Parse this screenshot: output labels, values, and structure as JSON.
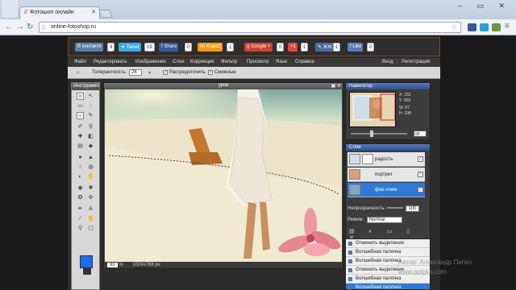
{
  "browser": {
    "tab_title": "Фотошоп онлайн",
    "url": "online-fotoshop.ru",
    "win_controls": "– ▭ ✕"
  },
  "social": [
    {
      "label": "контакте",
      "count": "4",
      "color": "#5b7fa6"
    },
    {
      "label": "Tweet",
      "count": "19",
      "color": "#3ea9e0"
    },
    {
      "label": "Share",
      "count": "0",
      "color": "#3b5998"
    },
    {
      "label": "Класс!",
      "count": "1",
      "color": "#f39a1e"
    },
    {
      "label": "Google +",
      "count": "0",
      "color": "#c9432f"
    },
    {
      "label": "+1",
      "count": "1",
      "color": "#d94c3d"
    },
    {
      "label": "ЖЖ",
      "count": "1",
      "color": "#4a6a9e"
    },
    {
      "label": "Like",
      "count": "0",
      "color": "#5a7ab8"
    }
  ],
  "menu": [
    "Файл",
    "Редактировать",
    "Изображение",
    "Слои",
    "Коррекция",
    "Фильтр",
    "Просмотр",
    "Язык",
    "Справка"
  ],
  "auth": {
    "login": "Вход",
    "register": "Регистрация"
  },
  "options": {
    "tolerance_label": "Толерантность:",
    "tolerance_value": "26",
    "smooth_label": "Рассредоточить",
    "contiguous_label": "Смежные"
  },
  "tools_title": "Инструменты",
  "canvas": {
    "title": "урок",
    "zoom": "90",
    "size": "1024x768 px"
  },
  "navigator": {
    "title": "Навигатор",
    "x_label": "X:",
    "x": "152",
    "y_label": "Y:",
    "y": "903",
    "w_label": "W:",
    "w": "87",
    "h_label": "H:",
    "h": "298",
    "zoom": "90"
  },
  "layers": {
    "title": "Слои",
    "items": [
      {
        "name": "радость",
        "selected": false
      },
      {
        "name": "портрет",
        "selected": false
      },
      {
        "name": "фон пляж",
        "selected": true
      }
    ],
    "opacity_label": "Непрозрачность:",
    "opacity": "100",
    "mode_label": "Режим:",
    "mode": "Normal"
  },
  "history": [
    {
      "label": "Отменить выделение",
      "selected": false
    },
    {
      "label": "Волшебная палочка",
      "selected": false
    },
    {
      "label": "Волшебная палочка",
      "selected": false
    },
    {
      "label": "Отменить выделение",
      "selected": false
    },
    {
      "label": "Волшебная палочка",
      "selected": false
    },
    {
      "label": "Волшебная палочка",
      "selected": true
    }
  ],
  "watermark": {
    "line1": "Автор: Александр Пипко",
    "line2": "www.apipko.com"
  }
}
